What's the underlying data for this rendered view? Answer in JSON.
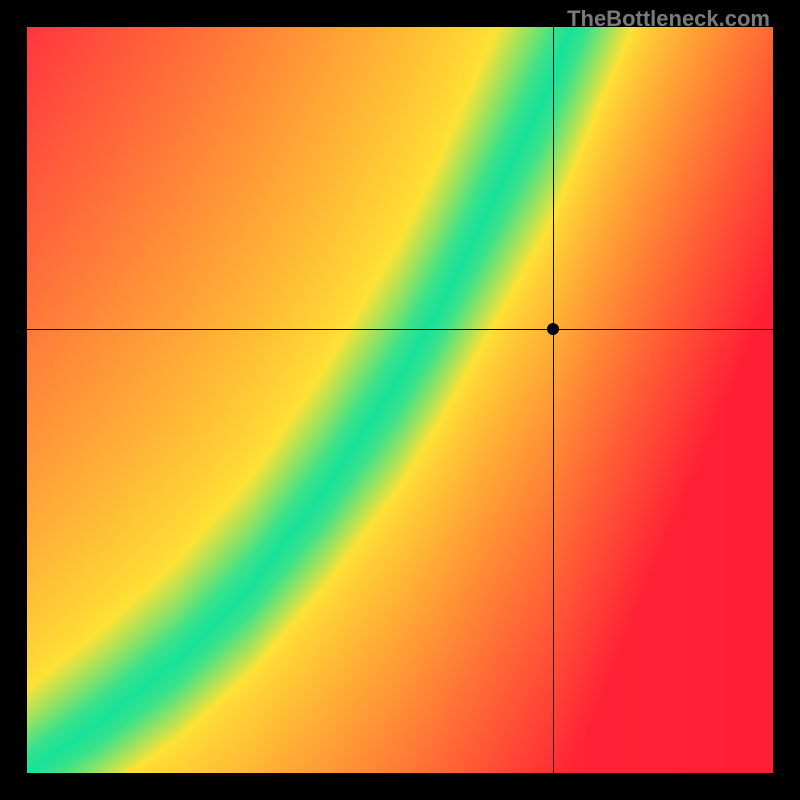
{
  "watermark": "TheBottleneck.com",
  "chart_data": {
    "type": "heatmap",
    "title": "",
    "xlabel": "",
    "ylabel": "",
    "xlim": [
      0,
      1
    ],
    "ylim": [
      0,
      1
    ],
    "crosshair": {
      "x": 0.706,
      "y": 0.595
    },
    "marker": {
      "x": 0.706,
      "y": 0.595
    },
    "ridge": [
      {
        "x": 0.0,
        "y": 0.0
      },
      {
        "x": 0.1,
        "y": 0.07
      },
      {
        "x": 0.2,
        "y": 0.15
      },
      {
        "x": 0.3,
        "y": 0.25
      },
      {
        "x": 0.4,
        "y": 0.38
      },
      {
        "x": 0.5,
        "y": 0.53
      },
      {
        "x": 0.55,
        "y": 0.62
      },
      {
        "x": 0.6,
        "y": 0.72
      },
      {
        "x": 0.65,
        "y": 0.82
      },
      {
        "x": 0.7,
        "y": 0.92
      },
      {
        "x": 0.73,
        "y": 1.0
      }
    ],
    "colors": {
      "ridge": "#18e29a",
      "mid": "#ffe335",
      "far_tr": "#ff9a2d",
      "far_bl": "#ff2f3a",
      "far_br": "#ff1f35",
      "far_tl": "#ff2140"
    },
    "note": "Values are normalized 0–1 on both axes; heat encodes closeness to the green optimal ridge. No tick labels or axis units are visible in the screenshot."
  }
}
